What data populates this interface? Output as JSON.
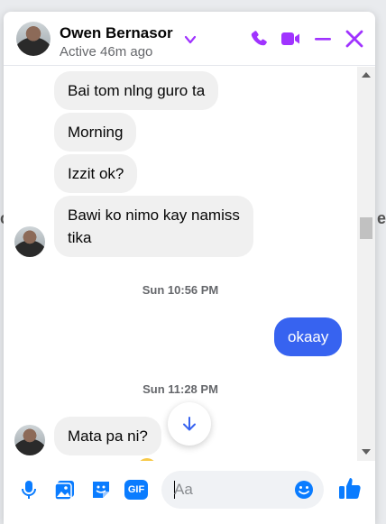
{
  "background": {
    "left_fragment": "c",
    "right_fragment": "e"
  },
  "header": {
    "name": "Owen Bernasor",
    "status": "Active 46m ago",
    "accent_color": "#a033ff",
    "icons": [
      "chevron-down-icon",
      "phone-icon",
      "video-camera-icon",
      "minimize-icon",
      "close-icon"
    ]
  },
  "messages": [
    {
      "sender": "them",
      "text": "Bai tom nlng guro ta"
    },
    {
      "sender": "them",
      "text": "Morning"
    },
    {
      "sender": "them",
      "text": "Izzit ok?"
    },
    {
      "sender": "them",
      "text": "Bawi ko nimo kay namiss tika"
    },
    {
      "type": "timestamp",
      "text": "Sun 10:56 PM"
    },
    {
      "sender": "me",
      "text": "okaay"
    },
    {
      "type": "timestamp",
      "text": "Sun 11:28 PM"
    },
    {
      "sender": "them",
      "text": "Mata pa ni?"
    }
  ],
  "composer": {
    "placeholder": "Aa",
    "accent_color": "#0a7cff",
    "icons": [
      "microphone-icon",
      "image-icon",
      "sticker-icon",
      "gif-icon",
      "emoji-icon",
      "thumbs-up-icon"
    ],
    "gif_label": "GIF"
  },
  "colors": {
    "my_bubble": "#3763f0",
    "their_bubble": "#f0f0f0"
  }
}
